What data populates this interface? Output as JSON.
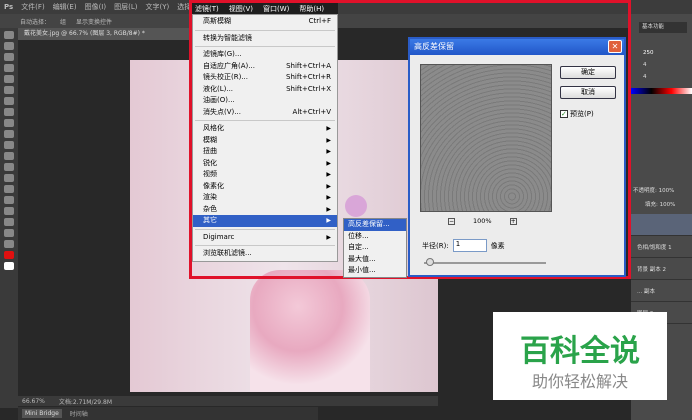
{
  "menubar": {
    "logo": "Ps",
    "items": [
      "文件(F)",
      "编辑(E)",
      "图像(I)",
      "图层(L)",
      "文字(Y)",
      "选择(S)"
    ],
    "filter_items": [
      "滤镜(T)",
      "视图(V)",
      "窗口(W)",
      "帮助(H)"
    ]
  },
  "options": {
    "auto_select": "自动选择：",
    "group": "组",
    "show_transform": "显示变换控件"
  },
  "document": {
    "tab": "戴花美女.jpg @ 66.7% (图层 3, RGB/8#) *"
  },
  "status": {
    "zoom": "66.67%",
    "doc": "文档:2.71M/29.8M"
  },
  "bridge": {
    "tabs": [
      "Mini Bridge",
      "时间轴"
    ]
  },
  "filter_menu": [
    {
      "label": "高斯模糊",
      "shortcut": "Ctrl+F"
    },
    {
      "sep": true
    },
    {
      "label": "转换为智能滤镜"
    },
    {
      "sep": true
    },
    {
      "label": "滤镜库(G)..."
    },
    {
      "label": "自适应广角(A)...",
      "shortcut": "Shift+Ctrl+A"
    },
    {
      "label": "镜头校正(R)...",
      "shortcut": "Shift+Ctrl+R"
    },
    {
      "label": "液化(L)...",
      "shortcut": "Shift+Ctrl+X"
    },
    {
      "label": "油画(O)..."
    },
    {
      "label": "消失点(V)...",
      "shortcut": "Alt+Ctrl+V"
    },
    {
      "sep": true
    },
    {
      "label": "风格化",
      "sub": true
    },
    {
      "label": "模糊",
      "sub": true
    },
    {
      "label": "扭曲",
      "sub": true
    },
    {
      "label": "锐化",
      "sub": true
    },
    {
      "label": "视频",
      "sub": true
    },
    {
      "label": "像素化",
      "sub": true
    },
    {
      "label": "渲染",
      "sub": true
    },
    {
      "label": "杂色",
      "sub": true
    },
    {
      "label": "其它",
      "sub": true,
      "hl": true
    },
    {
      "sep": true
    },
    {
      "label": "Digimarc",
      "sub": true
    },
    {
      "sep": true
    },
    {
      "label": "浏览联机滤镜..."
    }
  ],
  "submenu": [
    "高反差保留...",
    "位移...",
    "自定...",
    "最大值...",
    "最小值..."
  ],
  "dialog": {
    "title": "高反差保留",
    "ok": "确定",
    "cancel": "取消",
    "preview": "预览(P)",
    "zoom": "100%",
    "radius_label": "半径(R):",
    "radius": "1",
    "unit": "像素"
  },
  "right_panel": {
    "workspace": "基本功能",
    "rgb": [
      "250",
      "4",
      "4"
    ],
    "opacity_label": "不透明度:",
    "opacity": "100%",
    "fill_label": "填充:",
    "fill": "100%",
    "layers": [
      "色相/饱和度 1",
      "背景 副本 2",
      "... 副本",
      "图层 2"
    ]
  },
  "watermark": {
    "title": "百科全说",
    "subtitle": "助你轻松解决"
  },
  "colors": {
    "highlight": "#3160c6",
    "red_frame": "#e0112a",
    "wm_green": "#2aa34a"
  }
}
